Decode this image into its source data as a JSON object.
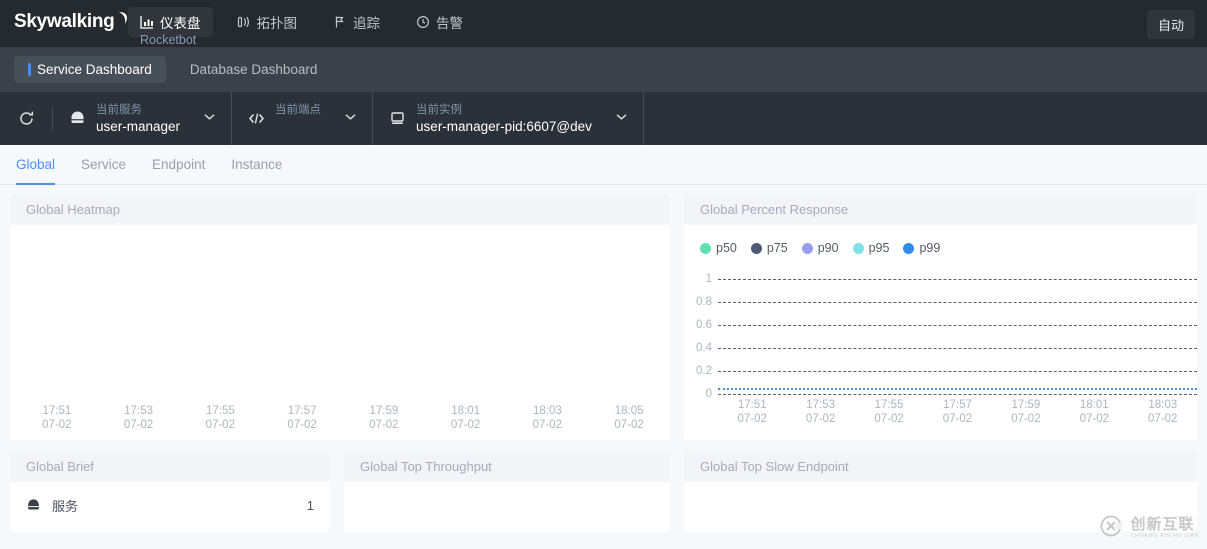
{
  "header": {
    "logo_text": "Skywalking",
    "nav": [
      {
        "label": "仪表盘",
        "icon": "chart-bar-icon",
        "active": true,
        "sub": "Rocketbot"
      },
      {
        "label": "拓扑图",
        "icon": "topology-icon",
        "active": false
      },
      {
        "label": "追踪",
        "icon": "trace-flag-icon",
        "active": false
      },
      {
        "label": "告警",
        "icon": "alarm-clock-icon",
        "active": false
      }
    ],
    "auto_button": "自动"
  },
  "dashboard_tabs": [
    {
      "label": "Service Dashboard",
      "active": true
    },
    {
      "label": "Database Dashboard",
      "active": false
    }
  ],
  "selectors": {
    "refresh_icon": "refresh-icon",
    "items": [
      {
        "icon": "service-icon",
        "label": "当前服务",
        "value": "user-manager"
      },
      {
        "icon": "code-endpoint-icon",
        "label": "当前端点",
        "value": ""
      },
      {
        "icon": "instance-monitor-icon",
        "label": "当前实例",
        "value": "user-manager-pid:6607@dev"
      }
    ]
  },
  "subtabs": [
    {
      "label": "Global",
      "active": true
    },
    {
      "label": "Service",
      "active": false
    },
    {
      "label": "Endpoint",
      "active": false
    },
    {
      "label": "Instance",
      "active": false
    }
  ],
  "panels": {
    "heatmap_title": "Global Heatmap",
    "percent_title": "Global Percent Response",
    "brief_title": "Global Brief",
    "throughput_title": "Global Top Throughput",
    "slow_endpoint_title": "Global Top Slow Endpoint"
  },
  "brief": {
    "rows": [
      {
        "icon": "service-icon",
        "name": "服务",
        "value": "1"
      }
    ]
  },
  "colors": {
    "accent": "#4a90f0",
    "p50": "#5fe0b0",
    "p75": "#4e5a72",
    "p90": "#9a9ef0",
    "p95": "#7fe3e8",
    "p99": "#2f8de4"
  },
  "chart_data": [
    {
      "type": "heatmap",
      "title": "Global Heatmap",
      "xlabel": "",
      "ylabel": "",
      "grid": false,
      "x": [
        "17:51\n07-02",
        "17:53\n07-02",
        "17:55\n07-02",
        "17:57\n07-02",
        "17:59\n07-02",
        "18:01\n07-02",
        "18:03\n07-02",
        "18:05\n07-02"
      ],
      "tick_times": [
        "17:51",
        "17:53",
        "17:55",
        "17:57",
        "17:59",
        "18:01",
        "18:03",
        "18:05"
      ],
      "tick_dates": [
        "07-02",
        "07-02",
        "07-02",
        "07-02",
        "07-02",
        "07-02",
        "07-02",
        "07-02"
      ],
      "values": []
    },
    {
      "type": "line",
      "title": "Global Percent Response",
      "xlabel": "",
      "ylabel": "",
      "grid": true,
      "legend_position": "top-left",
      "ylim": [
        0,
        1
      ],
      "yticks": [
        "1",
        "0.8",
        "0.6",
        "0.4",
        "0.2",
        "0"
      ],
      "tick_times": [
        "17:51",
        "17:53",
        "17:55",
        "17:57",
        "17:59",
        "18:01",
        "18:03"
      ],
      "tick_dates": [
        "07-02",
        "07-02",
        "07-02",
        "07-02",
        "07-02",
        "07-02",
        "07-02"
      ],
      "series": [
        {
          "name": "p50",
          "color": "#5fe0b0",
          "values": [
            0,
            0,
            0,
            0,
            0,
            0,
            0
          ]
        },
        {
          "name": "p75",
          "color": "#4e5a72",
          "values": [
            0,
            0,
            0,
            0,
            0,
            0,
            0
          ]
        },
        {
          "name": "p90",
          "color": "#9a9ef0",
          "values": [
            0,
            0,
            0,
            0,
            0,
            0,
            0
          ]
        },
        {
          "name": "p95",
          "color": "#7fe3e8",
          "values": [
            0,
            0,
            0,
            0,
            0,
            0,
            0
          ]
        },
        {
          "name": "p99",
          "color": "#2f8de4",
          "values": [
            0,
            0,
            0,
            0,
            0,
            0,
            0
          ]
        }
      ]
    }
  ],
  "watermark": {
    "cn": "创新互联",
    "en": "CHUANG XIN HU LIAN"
  }
}
